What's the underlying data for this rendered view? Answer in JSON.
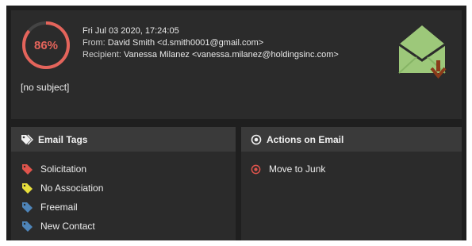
{
  "email": {
    "score_percent": 86,
    "score_text": "86%",
    "date": "Fri Jul 03 2020, 17:24:05",
    "from_label": "From:",
    "from_value": "David Smith <d.smith0001@gmail.com>",
    "recipient_label": "Recipient:",
    "recipient_value": "Vanessa Milanez <vanessa.milanez@holdingsinc.com>",
    "subject": "[no subject]"
  },
  "colors": {
    "gauge": "#e4645b",
    "envelope": "#9dc87a",
    "arrow": "#8a3a1a",
    "tag_red": "#e0544c",
    "tag_yellow": "#e8df3c",
    "tag_blue": "#4e84b8"
  },
  "tags_panel": {
    "title": "Email Tags",
    "icon": "tags-icon",
    "items": [
      {
        "label": "Solicitation",
        "color": "#e0544c"
      },
      {
        "label": "No Association",
        "color": "#e8df3c"
      },
      {
        "label": "Freemail",
        "color": "#4e84b8"
      },
      {
        "label": "New Contact",
        "color": "#4e84b8"
      }
    ]
  },
  "actions_panel": {
    "title": "Actions on Email",
    "icon": "target-icon",
    "items": [
      {
        "label": "Move to Junk",
        "icon": "target-icon"
      }
    ]
  }
}
